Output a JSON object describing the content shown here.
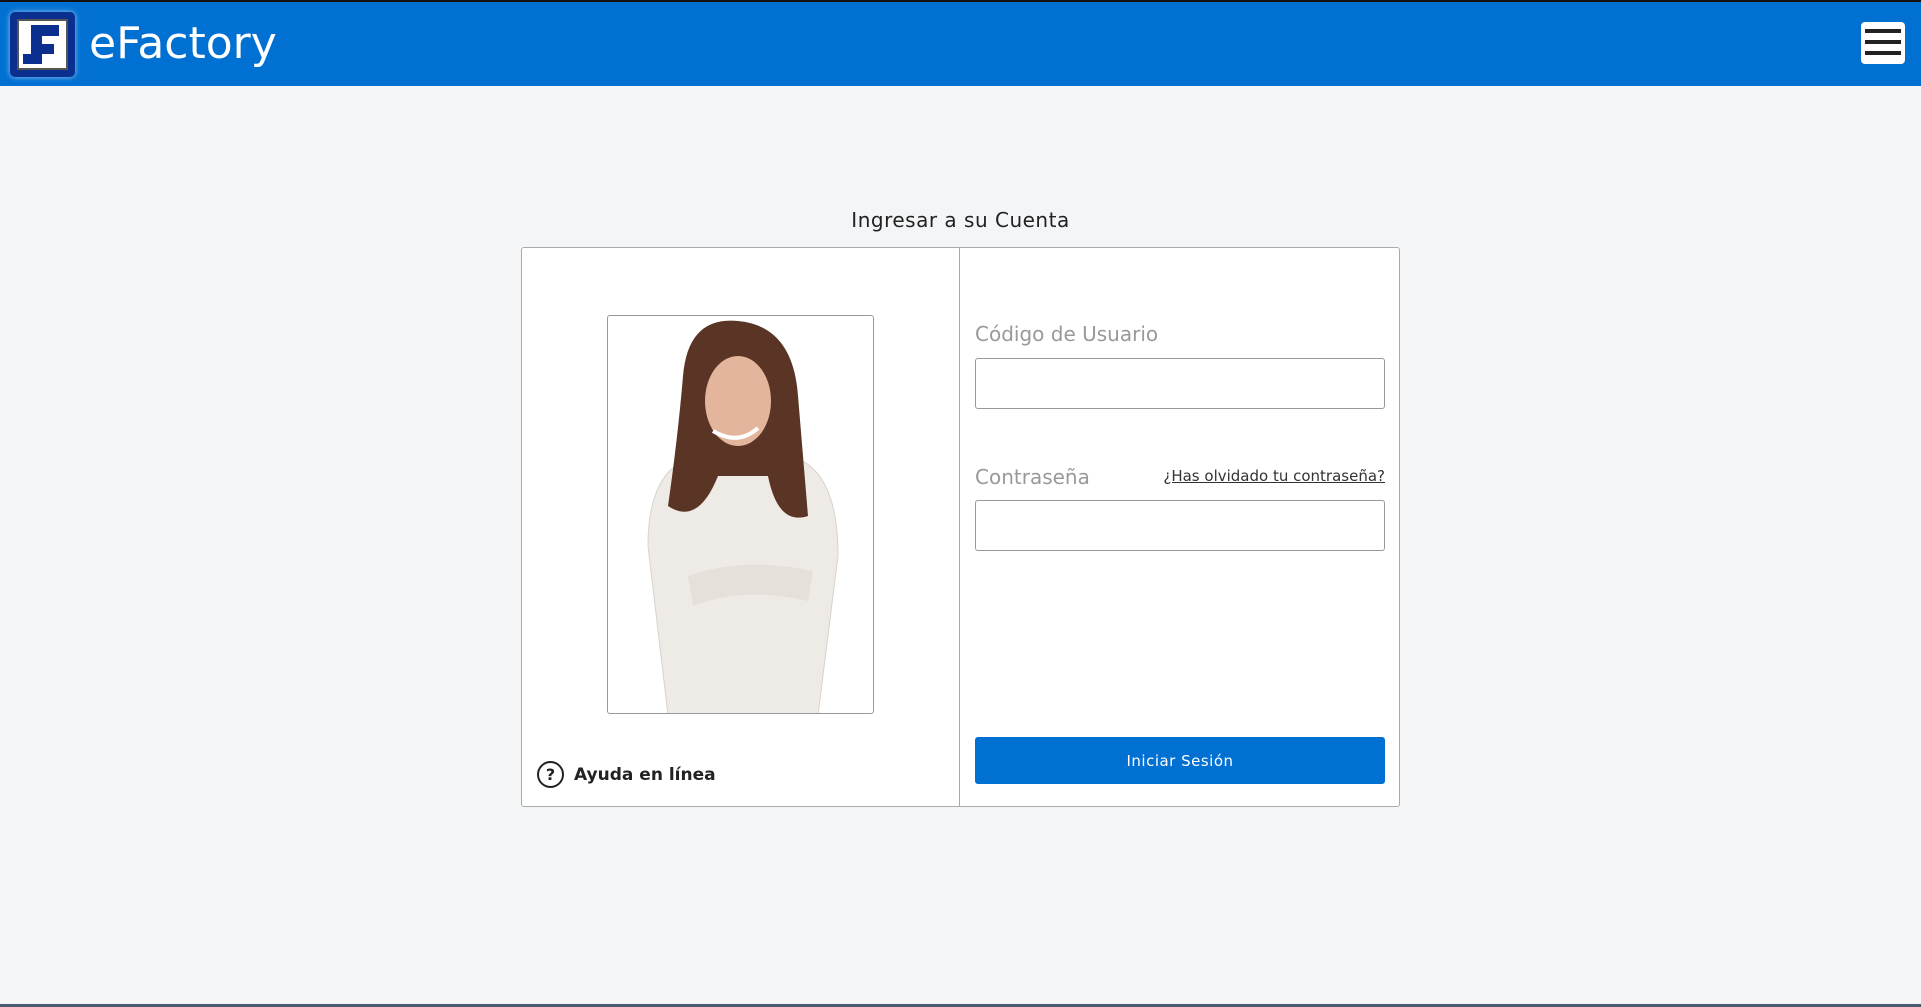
{
  "header": {
    "brand": "eFactory",
    "menu_icon": "hamburger-icon"
  },
  "login": {
    "title": "Ingresar a su Cuenta",
    "user_label": "Código de Usuario",
    "user_value": "",
    "password_label": "Contraseña",
    "password_value": "",
    "forgot_link": "¿Has olvidado tu contraseña?",
    "submit": "Iniciar Sesión",
    "help": "Ayuda en línea",
    "help_icon": "?"
  },
  "colors": {
    "accent": "#0070d2",
    "logo": "#0a2f8f"
  }
}
